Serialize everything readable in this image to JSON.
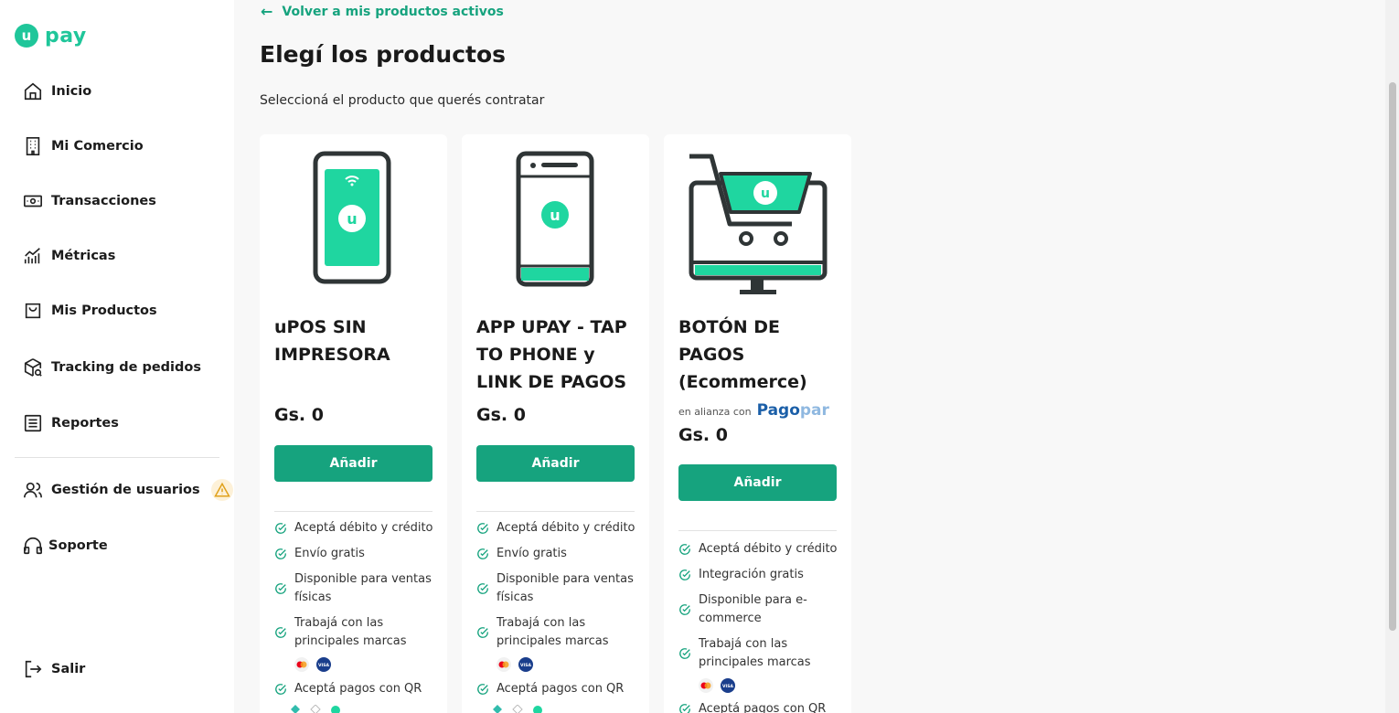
{
  "brand": {
    "logo_letter": "u",
    "logo_text": "pay",
    "accent_color": "#16a37e",
    "logo_color": "#1fc69a"
  },
  "sidebar": {
    "items": [
      {
        "label": "Inicio",
        "icon": "home-icon"
      },
      {
        "label": "Mi Comercio",
        "icon": "building-icon"
      },
      {
        "label": "Transacciones",
        "icon": "cash-icon"
      },
      {
        "label": "Métricas",
        "icon": "chart-icon"
      },
      {
        "label": "Mis Productos",
        "icon": "shopping-bag-icon"
      },
      {
        "label": "Tracking de pedidos",
        "icon": "package-search-icon"
      },
      {
        "label": "Reportes",
        "icon": "document-list-icon"
      },
      {
        "label": "Gestión de usuarios",
        "icon": "users-icon",
        "badge": "warning-icon"
      },
      {
        "label": "Soporte",
        "icon": "headphones-icon"
      },
      {
        "label": "Salir",
        "icon": "logout-icon"
      }
    ]
  },
  "main": {
    "back_link": "Volver a mis productos activos",
    "title": "Elegí los productos",
    "subtitle": "Seleccioná el producto que querés contratar"
  },
  "products": [
    {
      "title": "uPOS SIN IMPRESORA",
      "price": "Gs. 0",
      "button": "Añadir",
      "features": [
        "Aceptá débito y crédito",
        "Envío gratis",
        "Disponible para ventas físicas",
        "Trabajá con las principales marcas",
        "Aceptá pagos con QR"
      ]
    },
    {
      "title": "APP UPAY - TAP TO PHONE y LINK DE PAGOS",
      "price": "Gs. 0",
      "button": "Añadir",
      "features": [
        "Aceptá débito y crédito",
        "Envío gratis",
        "Disponible para ventas físicas",
        "Trabajá con las principales marcas",
        "Aceptá pagos con QR"
      ]
    },
    {
      "title": "BOTÓN DE PAGOS (Ecommerce)",
      "alliance_text": "en alianza con",
      "alliance_brand_a": "Pago",
      "alliance_brand_b": "par",
      "price": "Gs. 0",
      "button": "Añadir",
      "features": [
        "Aceptá débito y crédito",
        "Integración gratis",
        "Disponible para e-commerce",
        "Trabajá con las principales marcas",
        "Aceptá pagos con QR"
      ]
    }
  ],
  "card_brands": [
    "mastercard-icon",
    "visa-icon"
  ]
}
